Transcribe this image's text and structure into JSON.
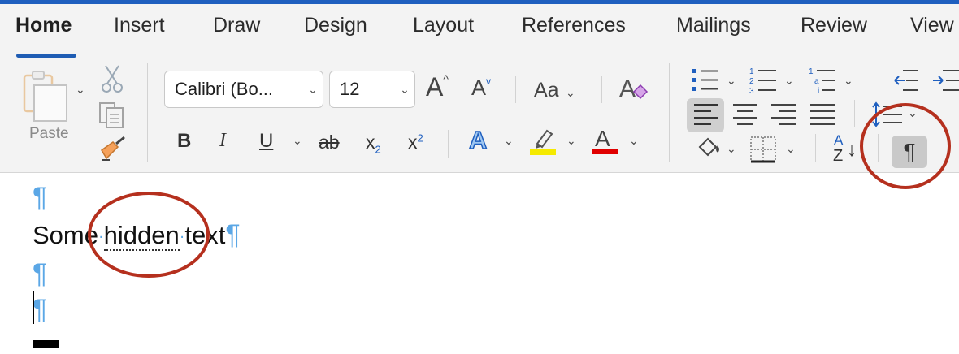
{
  "tabs": [
    {
      "label": "Home",
      "active": true
    },
    {
      "label": "Insert"
    },
    {
      "label": "Draw"
    },
    {
      "label": "Design"
    },
    {
      "label": "Layout"
    },
    {
      "label": "References"
    },
    {
      "label": "Mailings"
    },
    {
      "label": "Review"
    },
    {
      "label": "View"
    }
  ],
  "clipboard": {
    "paste_label": "Paste"
  },
  "font": {
    "family": "Calibri (Bo...",
    "size": "12",
    "grow_label": "A",
    "shrink_label": "A",
    "case_label": "Aa",
    "bold": "B",
    "italic": "I",
    "underline": "U",
    "strike": "ab",
    "subscript": "x",
    "subscript_mark": "2",
    "superscript": "x",
    "superscript_mark": "2",
    "text_effects": "A",
    "font_color": "A",
    "highlight_color": "#f5ea00",
    "font_color_value": "#e00000"
  },
  "paragraph": {
    "sort_top": "A",
    "sort_bottom": "Z",
    "show_marks": "¶",
    "show_marks_active": true
  },
  "document": {
    "mark": "¶",
    "line2_word1": "Some",
    "line2_word2": "hidden",
    "line2_word3": "text",
    "space_dot": "·"
  },
  "colors": {
    "accent_blue": "#1f5fbf",
    "mark_blue": "#5ba7e6",
    "annotation_red": "#b5301e"
  }
}
